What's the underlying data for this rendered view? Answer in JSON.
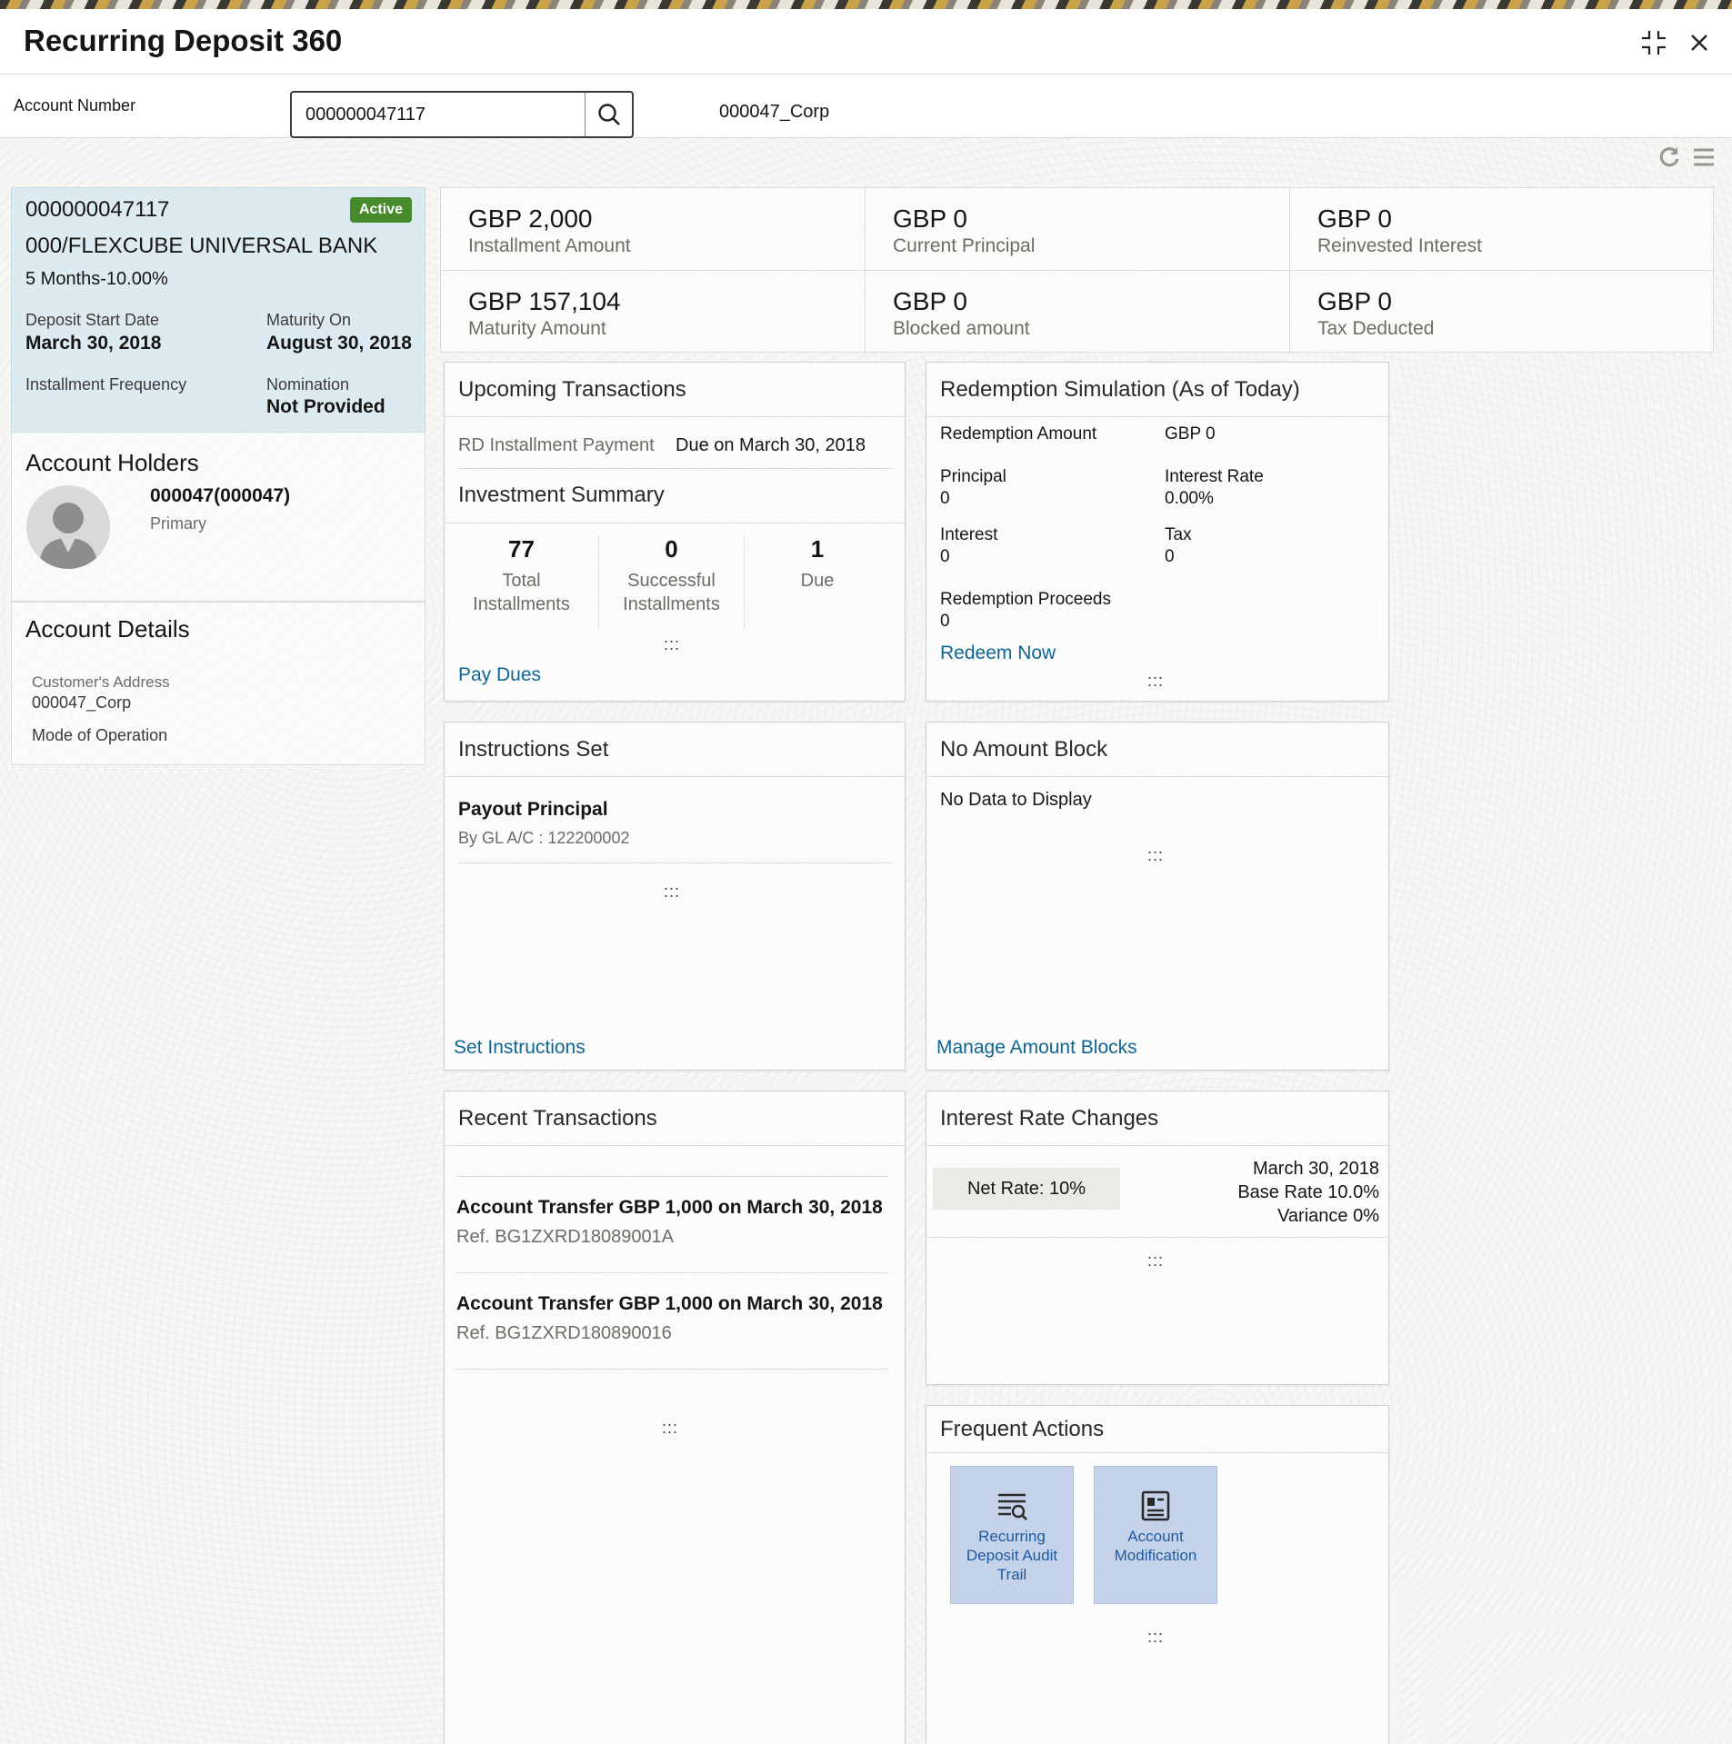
{
  "window": {
    "title": "Recurring Deposit 360"
  },
  "search": {
    "label": "Account Number",
    "value": "000000047117",
    "customer_name": "000047_Corp"
  },
  "summary": {
    "account_number": "000000047117",
    "status": "Active",
    "status_color": "#478a2e",
    "bank": "000/FLEXCUBE UNIVERSAL BANK",
    "term": "5 Months-10.00%",
    "start_label": "Deposit Start Date",
    "start_value": "March 30, 2018",
    "maturity_label": "Maturity On",
    "maturity_value": "August 30, 2018",
    "frequency_label": "Installment Frequency",
    "nomination_label": "Nomination",
    "nomination_value": "Not Provided"
  },
  "holders": {
    "title": "Account Holders",
    "name": "000047(000047)",
    "role": "Primary"
  },
  "details": {
    "title": "Account Details",
    "address_label": "Customer's Address",
    "address_value": "000047_Corp",
    "mode_label": "Mode of Operation"
  },
  "kpis": [
    {
      "value": "GBP 2,000",
      "label": "Installment Amount"
    },
    {
      "value": "GBP 0",
      "label": "Current Principal"
    },
    {
      "value": "GBP 0",
      "label": "Reinvested Interest"
    },
    {
      "value": "GBP 157,104",
      "label": "Maturity Amount"
    },
    {
      "value": "GBP 0",
      "label": "Blocked amount"
    },
    {
      "value": "GBP 0",
      "label": "Tax Deducted"
    }
  ],
  "upcoming": {
    "title": "Upcoming Transactions",
    "item_label": "RD Installment Payment",
    "item_due": "Due on March 30, 2018",
    "inv_title": "Investment Summary",
    "stats": [
      {
        "value": "77",
        "line1": "Total",
        "line2": "Installments"
      },
      {
        "value": "0",
        "line1": "Successful",
        "line2": "Installments"
      },
      {
        "value": "1",
        "line1": "Due",
        "line2": ""
      }
    ],
    "link": "Pay Dues"
  },
  "redemption": {
    "title": "Redemption Simulation (As of Today)",
    "amount_label": "Redemption Amount",
    "amount_value": "GBP 0",
    "principal_label": "Principal",
    "principal_value": "0",
    "rate_label": "Interest Rate",
    "rate_value": "0.00%",
    "interest_label": "Interest",
    "interest_value": "0",
    "tax_label": "Tax",
    "tax_value": "0",
    "proceeds_label": "Redemption Proceeds",
    "proceeds_value": "0",
    "link": "Redeem Now"
  },
  "instructions": {
    "title": "Instructions Set",
    "item_title": "Payout Principal",
    "item_sub": "By GL A/C : 122200002",
    "link": "Set Instructions"
  },
  "amount_block": {
    "title": "No Amount Block",
    "empty": "No Data to Display",
    "link": "Manage Amount Blocks"
  },
  "recent": {
    "title": "Recent Transactions",
    "items": [
      {
        "title": "Account Transfer GBP 1,000 on March 30, 2018",
        "ref": "Ref. BG1ZXRD18089001A"
      },
      {
        "title": "Account Transfer GBP 1,000 on March 30, 2018",
        "ref": "Ref. BG1ZXRD180890016"
      }
    ]
  },
  "rates": {
    "title": "Interest Rate Changes",
    "net_rate": "Net Rate: 10%",
    "date": "March 30, 2018",
    "base_rate": "Base Rate 10.0%",
    "variance": "Variance 0%"
  },
  "frequent": {
    "title": "Frequent Actions",
    "tiles": [
      {
        "label": "Recurring Deposit Audit Trail",
        "icon": "audit-trail-icon"
      },
      {
        "label": "Account Modification",
        "icon": "account-modification-icon"
      }
    ]
  },
  "grip_glyph": ":::",
  "accent_link_color": "#0f6594"
}
